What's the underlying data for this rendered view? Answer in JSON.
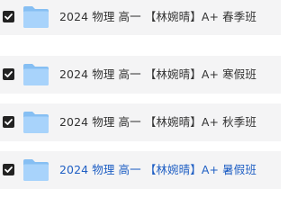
{
  "files": [
    {
      "name": "2024 物理 高一 【林婉晴】A+ 春季班",
      "checked": true
    },
    {
      "name": "2024 物理 高一 【林婉晴】A+ 寒假班",
      "checked": true
    },
    {
      "name": "2024 物理 高一 【林婉晴】A+ 秋季班",
      "checked": true
    },
    {
      "name": "2024 物理 高一 【林婉晴】A+ 暑假班",
      "checked": true
    }
  ],
  "colors": {
    "row_background": "#f4f4f5",
    "checkbox": "#222222",
    "text": "#333333",
    "link_text": "#1f5fc4",
    "folder_back": "#86bff3",
    "folder_front": "#a8d3fb"
  },
  "icons": {
    "checkbox": "checkbox-checked-icon",
    "folder": "folder-icon"
  }
}
